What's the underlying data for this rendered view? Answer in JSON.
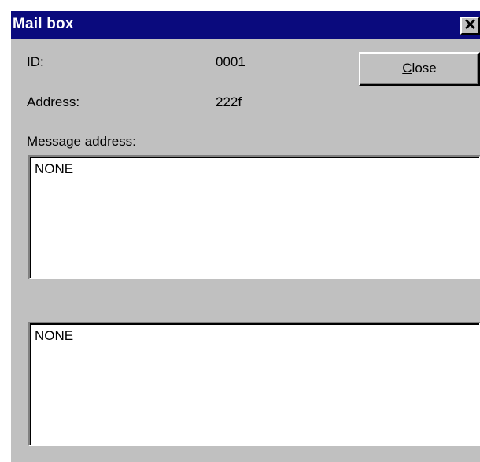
{
  "window": {
    "title": "Mail box",
    "close_glyph": "✕"
  },
  "fields": {
    "id_label": "ID:",
    "id_value": "0001",
    "address_label": "Address:",
    "address_value": "222f",
    "message_address_label": "Message address:"
  },
  "buttons": {
    "close_accel": "C",
    "close_rest": "lose"
  },
  "textboxes": {
    "message_address_value": "NONE",
    "second_value": "NONE"
  },
  "colors": {
    "titlebar": "#0a0a7d",
    "face": "#c0c0c0"
  }
}
